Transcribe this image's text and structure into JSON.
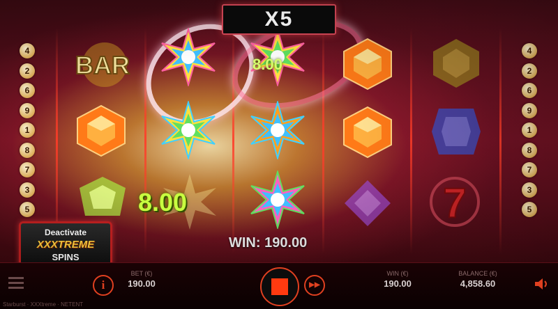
{
  "header": {
    "multiplier_label": "X5"
  },
  "paylines": {
    "left": [
      "4",
      "2",
      "6",
      "9",
      "1",
      "8",
      "7",
      "3",
      "5"
    ],
    "right": [
      "4",
      "2",
      "6",
      "9",
      "1",
      "8",
      "7",
      "3",
      "5"
    ]
  },
  "reels": [
    [
      "bar",
      "orange-gem",
      "green-gem"
    ],
    [
      "star-rainbow",
      "star-rainbow",
      "star-rainbow-faded"
    ],
    [
      "star-rainbow",
      "star-rainbow",
      "star-rainbow"
    ],
    [
      "orange-gem",
      "orange-gem",
      "purple-gem"
    ],
    [
      "yellow-gem-dim",
      "blue-gem",
      "seven"
    ]
  ],
  "symbol_text": {
    "bar": "BAR",
    "seven": "7"
  },
  "wins": {
    "big_value": "8.00",
    "small_value": "8.00",
    "total_label": "WIN: 190.00"
  },
  "xxxtreme": {
    "top": "Deactivate",
    "middle": "XXXTREME",
    "bottom": "SPINS"
  },
  "bottom_bar": {
    "bet_label": "BET (€)",
    "bet_value": "190.00",
    "win_label": "WIN (€)",
    "win_value": "190.00",
    "balance_label": "BALANCE (€)",
    "balance_value": "4,858.60",
    "info_glyph": "i",
    "autoplay_glyph": "▶▶",
    "footer": "Starburst · XXXtreme · NETENT"
  },
  "colors": {
    "accent": "#e04020",
    "gem_orange": "#ff7a18",
    "gem_purple": "#9a4ad0",
    "gem_blue": "#3a50c8",
    "win_text": "#c8ff40"
  }
}
